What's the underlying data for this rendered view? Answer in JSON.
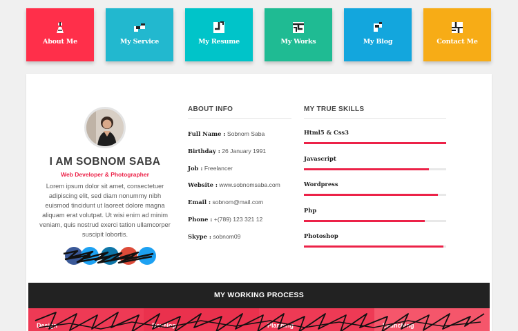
{
  "nav": {
    "tiles": [
      {
        "label": "About Me",
        "icon": "person-icon",
        "color": "#ff2f4a"
      },
      {
        "label": "My Service",
        "icon": "service-icon",
        "color": "#22b8cf"
      },
      {
        "label": "My Resume",
        "icon": "resume-icon",
        "color": "#00c4c9"
      },
      {
        "label": "My Works",
        "icon": "works-icon",
        "color": "#1fbb93"
      },
      {
        "label": "My Blog",
        "icon": "blog-icon",
        "color": "#13a6dd"
      },
      {
        "label": "Contact Me",
        "icon": "contact-icon",
        "color": "#f7ac16"
      }
    ]
  },
  "profile": {
    "name": "I AM SOBNOM SABA",
    "role": "Web Developer & Photographer",
    "bio": "Lorem ipsum dolor sit amet, consectetuer adipiscing elit, sed diam nonummy nibh euismod tincidunt ut laoreet dolore magna aliquam erat volutpat. Ut wisi enim ad minim veniam, quis nostrud exerci tation ullamcorper suscipit lobortis.",
    "social_colors": [
      "#3b5998",
      "#1da1f2",
      "#0e76a8",
      "#dd4b39",
      "#1da1f2"
    ]
  },
  "about": {
    "title": "ABOUT INFO",
    "rows": [
      {
        "label": "Full Name :",
        "value": "Sobnom Saba"
      },
      {
        "label": "Birthday :",
        "value": "26 January 1991"
      },
      {
        "label": "Job :",
        "value": "Freelancer"
      },
      {
        "label": "Website :",
        "value": "www.sobnomsaba.com"
      },
      {
        "label": "Email :",
        "value": "sobnom@mail.com"
      },
      {
        "label": "Phone :",
        "value": "+(789) 123 321 12"
      },
      {
        "label": "Skype :",
        "value": "sobnom09"
      }
    ]
  },
  "skills": {
    "title": "MY TRUE SKILLS",
    "items": [
      {
        "name": "Html5 & Css3",
        "level": 1.0
      },
      {
        "name": "Javascript",
        "level": 0.88
      },
      {
        "name": "Wordpress",
        "level": 0.94
      },
      {
        "name": "Php",
        "level": 0.85
      },
      {
        "name": "Photoshop",
        "level": 0.98
      }
    ]
  },
  "process": {
    "title": "MY WORKING PROCESS",
    "steps": [
      {
        "label": "Design"
      },
      {
        "label": "Develop"
      },
      {
        "label": "Planning"
      },
      {
        "label": "Launching"
      }
    ]
  },
  "colors": {
    "accent": "#ec2248",
    "dark": "#222222"
  }
}
